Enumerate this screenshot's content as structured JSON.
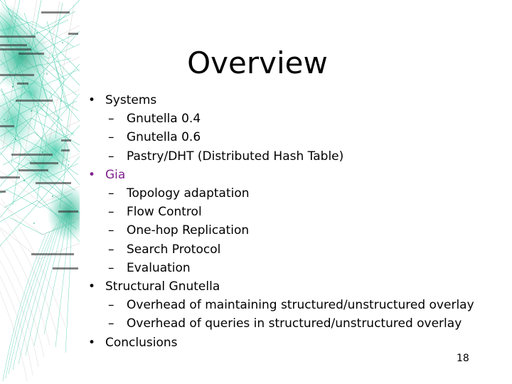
{
  "slide": {
    "title": "Overview",
    "page_number": "18",
    "background_color": "#ffffff",
    "accent_color": "#80268f",
    "graph_color": "#2ec4a0"
  },
  "decoration": {
    "graph_image_name": "network-graph-visualization",
    "graph_edge_color": "#2ec4a0",
    "graph_dense_color": "#1faa85"
  },
  "outline": {
    "bullet_glyph": "•",
    "dash_glyph": "–",
    "items": [
      {
        "label": "Systems",
        "accent": false,
        "sub": [
          "Gnutella 0.4",
          "Gnutella 0.6",
          "Pastry/DHT (Distributed Hash Table)"
        ]
      },
      {
        "label": "Gia",
        "accent": true,
        "sub": [
          "Topology adaptation",
          "Flow Control",
          "One-hop Replication",
          "Search Protocol",
          "Evaluation"
        ]
      },
      {
        "label": "Structural Gnutella",
        "accent": false,
        "sub": [
          "Overhead of maintaining structured/unstructured overlay",
          "Overhead of queries in structured/unstructured overlay"
        ]
      },
      {
        "label": "Conclusions",
        "accent": false,
        "sub": []
      }
    ]
  }
}
